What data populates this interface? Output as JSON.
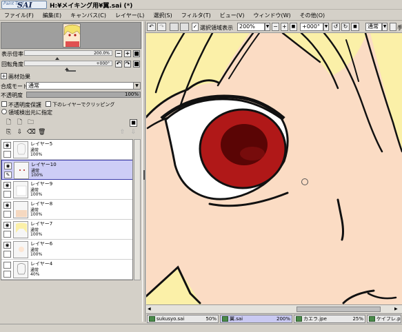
{
  "title": {
    "logo_small": "Paint Tool",
    "logo_big": "SAI",
    "file": "H:¥メイキング用¥翼.sai (*)"
  },
  "menu": [
    "ファイル(F)",
    "編集(E)",
    "キャンバス(C)",
    "レイヤー(L)",
    "選択(S)",
    "フィルタ(T)",
    "ビュー(V)",
    "ウィンドウ(W)",
    "その他(O)"
  ],
  "navigator": {
    "zoom_label": "表示倍率",
    "zoom_value": "200.0%",
    "rotate_label": "回転角度",
    "rotate_value": "+000°"
  },
  "layer_panel": {
    "texture_label": "画材効果",
    "blend_label": "合成モード",
    "blend_value": "通常",
    "opacity_label": "不透明度",
    "opacity_value": "100%",
    "preserve_opacity": "不透明度保護",
    "clip_label": "下のレイヤーでクリッピング",
    "selection_source": "領域検出元に指定",
    "layers": [
      {
        "name": "レイヤー5",
        "mode": "通常",
        "opacity": "100%",
        "visible": true,
        "selected": false
      },
      {
        "name": "レイヤー10",
        "mode": "通常",
        "opacity": "100%",
        "visible": true,
        "selected": true
      },
      {
        "name": "レイヤー9",
        "mode": "通常",
        "opacity": "100%",
        "visible": true,
        "selected": false
      },
      {
        "name": "レイヤー8",
        "mode": "通常",
        "opacity": "100%",
        "visible": true,
        "selected": false
      },
      {
        "name": "レイヤー7",
        "mode": "通常",
        "opacity": "100%",
        "visible": true,
        "selected": false
      },
      {
        "name": "レイヤー6",
        "mode": "通常",
        "opacity": "100%",
        "visible": true,
        "selected": false
      },
      {
        "name": "レイヤー4",
        "mode": "通常",
        "opacity": "40%",
        "visible": false,
        "selected": false
      }
    ]
  },
  "toolbar": {
    "selection_display": "選択領域表示",
    "zoom": "200%",
    "rotation": "+000°",
    "mode": "通常",
    "trailing": "手"
  },
  "tabs": [
    {
      "name": "sukusyo.sai",
      "zoom": "50%",
      "active": false
    },
    {
      "name": "翼.sai",
      "zoom": "200%",
      "active": true
    },
    {
      "name": "カエラ.jpe",
      "zoom": "25%",
      "active": false
    },
    {
      "name": "ケイフレ.png",
      "zoom": "",
      "active": false
    }
  ],
  "colors": {
    "skin": "#fbdcc4",
    "hair": "#fbf0a8",
    "iris_outer": "#b01818",
    "iris_inner": "#5a0505",
    "selected_layer": "#cdcdf6",
    "panel": "#d4d0c8"
  }
}
